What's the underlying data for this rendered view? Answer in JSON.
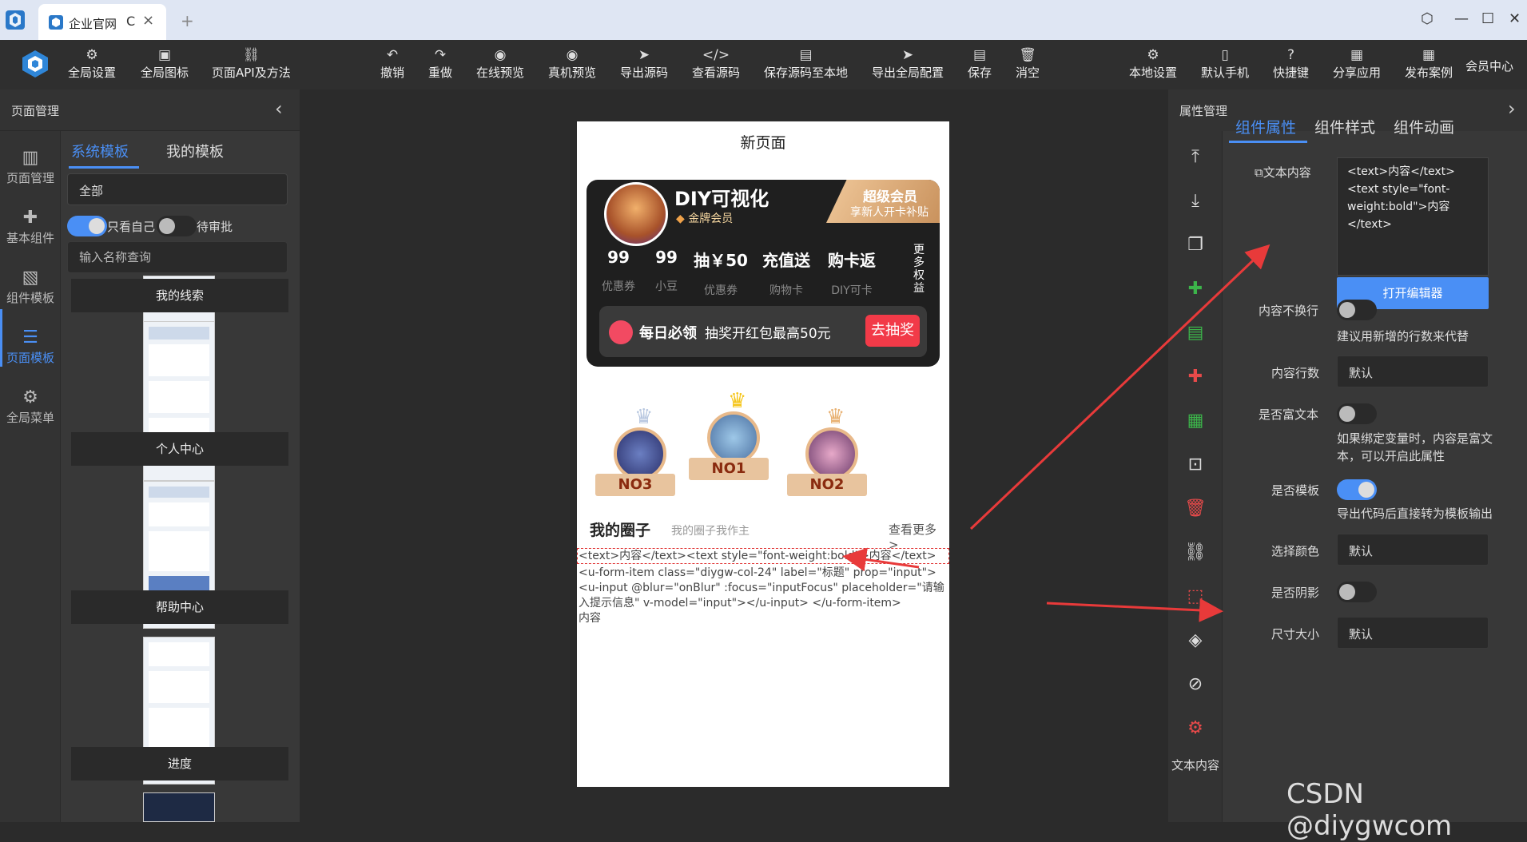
{
  "tabbar": {
    "tab_title": "企业官网",
    "refresh": "C",
    "close": "×",
    "new_tab": "+"
  },
  "toolbar": {
    "global_settings": "全局设置",
    "global_icons": "全局图标",
    "page_api": "页面API及方法",
    "undo": "撤销",
    "redo": "重做",
    "online_preview": "在线预览",
    "device_preview": "真机预览",
    "export_source": "导出源码",
    "view_source": "查看源码",
    "save_source_local": "保存源码至本地",
    "export_global_config": "导出全局配置",
    "save": "保存",
    "clear": "消空",
    "local_settings": "本地设置",
    "default_phone": "默认手机",
    "shortcuts": "快捷键",
    "share_app": "分享应用",
    "publish_case": "发布案例",
    "member_center": "会员中心"
  },
  "left": {
    "header": "页面管理",
    "nav": [
      "页面管理",
      "基本组件",
      "组件模板",
      "页面模板",
      "全局菜单"
    ],
    "tabs": [
      "系统模板",
      "我的模板"
    ],
    "filter_selected": "全部",
    "only_mine": "只看自己",
    "pending": "待审批",
    "search_placeholder": "输入名称查询",
    "templates": [
      "我的线索",
      "个人中心",
      "帮助中心",
      "进度"
    ]
  },
  "phone": {
    "title": "新页面",
    "vip": {
      "name": "DIY可视化",
      "badge": "金牌会员",
      "super_title": "超级会员",
      "super_sub": "享新人开卡补贴",
      "stats": [
        {
          "value": "99",
          "label": "优惠券"
        },
        {
          "value": "99",
          "label": "小豆"
        },
        {
          "value": "抽￥50",
          "label": "优惠券"
        },
        {
          "value": "充值送",
          "label": "购物卡"
        },
        {
          "value": "购卡返",
          "label": "DIY可卡"
        }
      ],
      "more": "更多权益",
      "daily_title": "每日必领",
      "daily_text": "抽奖开红包最高50元",
      "daily_btn": "去抽奖"
    },
    "ranks": [
      "NO3",
      "NO1",
      "NO2"
    ],
    "circle": {
      "title": "我的圈子",
      "subtitle": "我的圈子我作主",
      "more": "查看更多 >"
    },
    "code_line": "<text>内容</text><text style=\"font-weight:bold\">内容</text>",
    "code_block": "<u-form-item class=\"diygw-col-24\" label=\"标题\" prop=\"input\"> <u-input @blur=\"onBlur\" :focus=\"inputFocus\" placeholder=\"请输入提示信息\" v-model=\"input\"></u-input> </u-form-item>",
    "code_tail": "内容"
  },
  "right": {
    "header": "属性管理",
    "tabs": [
      "组件属性",
      "组件样式",
      "组件动画"
    ],
    "nav_label": "文本内容",
    "text_content_label": "文本内容",
    "text_content_value": "<text>内容</text><text style=\"font-weight:bold\">内容</text>",
    "open_editor": "打开编辑器",
    "no_wrap_label": "内容不换行",
    "no_wrap_hint": "建议用新增的行数来代替",
    "lines_label": "内容行数",
    "lines_value": "默认",
    "rich_label": "是否富文本",
    "rich_hint": "如果绑定变量时，内容是富文本，可以开启此属性",
    "template_label": "是否模板",
    "template_hint": "导出代码后直接转为模板输出",
    "color_label": "选择颜色",
    "color_value": "默认",
    "shadow_label": "是否阴影",
    "size_label": "尺寸大小",
    "size_value": "默认"
  },
  "watermark": "CSDN @diygwcom",
  "colors": {
    "accent": "#4a8ff5",
    "arrow": "#e83a3a",
    "dark_bg": "#2b2b2b"
  }
}
